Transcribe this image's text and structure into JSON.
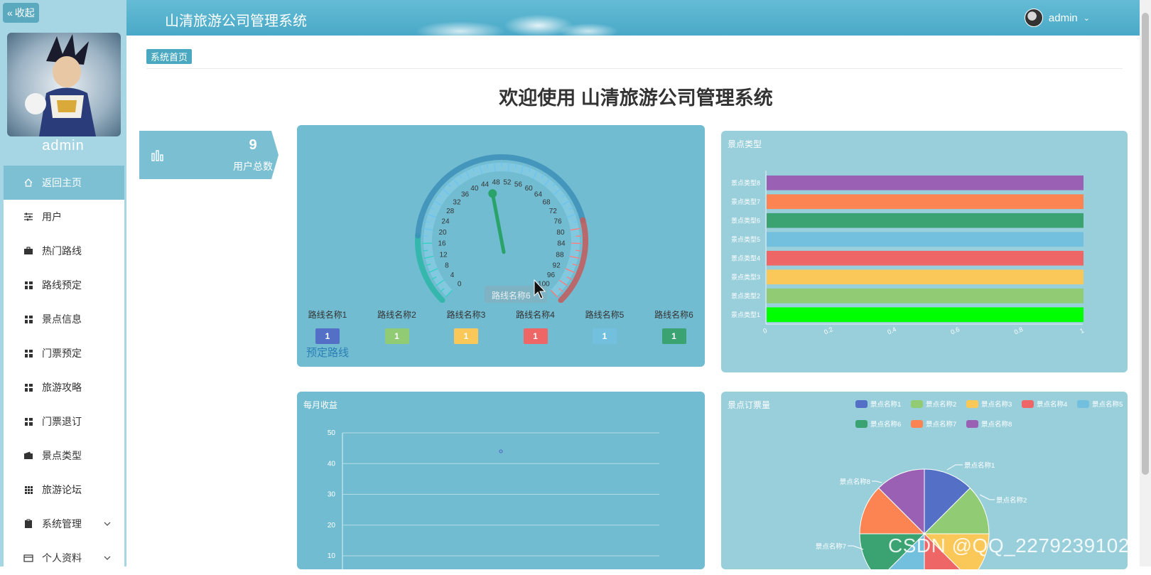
{
  "sidebar": {
    "collapse_label": "收起",
    "username": "admin",
    "menu": [
      {
        "label": "返回主页",
        "icon": "home-icon",
        "active": true,
        "expandable": false
      },
      {
        "label": "用户",
        "icon": "sliders-icon",
        "active": false,
        "expandable": false
      },
      {
        "label": "热门路线",
        "icon": "briefcase-icon",
        "active": false,
        "expandable": false
      },
      {
        "label": "路线预定",
        "icon": "grid-icon",
        "active": false,
        "expandable": false
      },
      {
        "label": "景点信息",
        "icon": "grid-icon",
        "active": false,
        "expandable": false
      },
      {
        "label": "门票预定",
        "icon": "grid-icon",
        "active": false,
        "expandable": false
      },
      {
        "label": "旅游攻略",
        "icon": "grid-icon",
        "active": false,
        "expandable": false
      },
      {
        "label": "门票退订",
        "icon": "grid-icon",
        "active": false,
        "expandable": false
      },
      {
        "label": "景点类型",
        "icon": "wallet-icon",
        "active": false,
        "expandable": false
      },
      {
        "label": "旅游论坛",
        "icon": "grid9-icon",
        "active": false,
        "expandable": false
      },
      {
        "label": "系统管理",
        "icon": "clipboard-icon",
        "active": false,
        "expandable": true
      },
      {
        "label": "个人资料",
        "icon": "card-icon",
        "active": false,
        "expandable": true
      }
    ]
  },
  "header": {
    "title": "山清旅游公司管理系统",
    "username": "admin"
  },
  "breadcrumb": "系统首页",
  "welcome": "欢迎使用 山清旅游公司管理系统",
  "stat": {
    "value": "9",
    "label": "用户总数"
  },
  "gauge": {
    "title": "预定路线",
    "ticks": [
      "0",
      "4",
      "8",
      "12",
      "16",
      "20",
      "24",
      "28",
      "32",
      "36",
      "40",
      "44",
      "48",
      "52",
      "56",
      "60",
      "64",
      "68",
      "72",
      "76",
      "80",
      "84",
      "88",
      "92",
      "96",
      "100"
    ],
    "min": 0,
    "max": 100,
    "pointer_value": 46,
    "tooltip": "路线名称6",
    "routes": [
      {
        "name": "路线名称1",
        "value": "1",
        "color": "#5470c6"
      },
      {
        "name": "路线名称2",
        "value": "1",
        "color": "#91cc75"
      },
      {
        "name": "路线名称3",
        "value": "1",
        "color": "#fac858"
      },
      {
        "name": "路线名称4",
        "value": "1",
        "color": "#ee6666"
      },
      {
        "name": "路线名称5",
        "value": "1",
        "color": "#73c0de"
      },
      {
        "name": "路线名称6",
        "value": "1",
        "color": "#3ba272"
      }
    ]
  },
  "chart_data": [
    {
      "type": "bar",
      "orientation": "horizontal",
      "title": "景点类型",
      "categories": [
        "景点类型1",
        "景点类型2",
        "景点类型3",
        "景点类型4",
        "景点类型5",
        "景点类型6",
        "景点类型7",
        "景点类型8"
      ],
      "values": [
        1,
        1,
        1,
        1,
        1,
        1,
        1,
        1
      ],
      "colors": [
        "#00ff00",
        "#91cc75",
        "#fac858",
        "#ee6666",
        "#73c0de",
        "#3ba272",
        "#fc8452",
        "#9a60b4"
      ],
      "xticks": [
        "0",
        "0.2",
        "0.4",
        "0.6",
        "0.8",
        "1"
      ],
      "xlim": [
        0,
        1
      ]
    },
    {
      "type": "line",
      "title": "每月收益",
      "yticks": [
        "50",
        "40",
        "30",
        "20",
        "10"
      ],
      "ylim": [
        0,
        50
      ],
      "points": [
        {
          "y": 44
        }
      ]
    },
    {
      "type": "pie",
      "title": "景点订票量",
      "legend": [
        "景点名称1",
        "景点名称2",
        "景点名称3",
        "景点名称4",
        "景点名称5",
        "景点名称6",
        "景点名称7",
        "景点名称8"
      ],
      "colors": [
        "#5470c6",
        "#91cc75",
        "#fac858",
        "#ee6666",
        "#73c0de",
        "#3ba272",
        "#fc8452",
        "#9a60b4"
      ],
      "values": [
        1,
        1,
        1,
        1,
        1,
        1,
        1,
        1
      ],
      "visible_labels": [
        "景点名称1",
        "景点名称2",
        "景点名称7",
        "景点名称8"
      ]
    }
  ],
  "watermark": "CSDN @QQ_2279239102"
}
